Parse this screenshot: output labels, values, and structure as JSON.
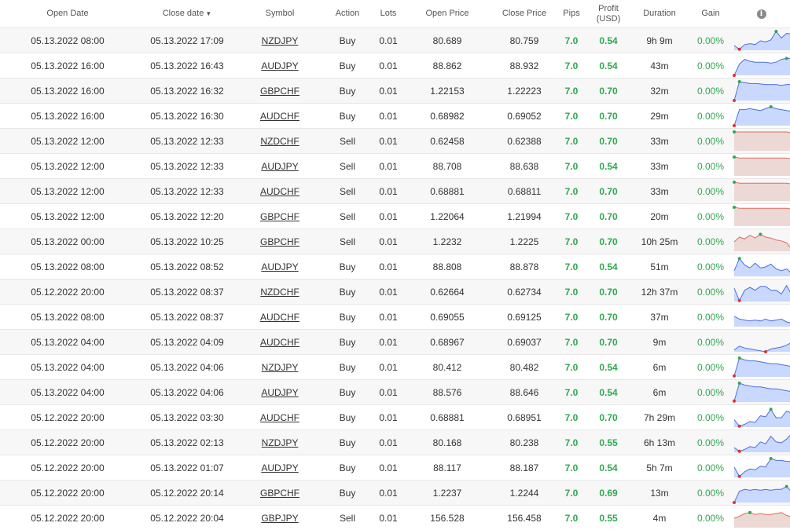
{
  "header": {
    "open_date": "Open Date",
    "close_date": "Close date",
    "close_date_sort": "▼",
    "symbol": "Symbol",
    "action": "Action",
    "lots": "Lots",
    "open_price": "Open Price",
    "close_price": "Close Price",
    "pips": "Pips",
    "profit_line1": "Profit",
    "profit_line2": "(USD)",
    "duration": "Duration",
    "gain": "Gain",
    "info_icon": "i"
  },
  "colors": {
    "profit": "#2fa84f",
    "buy_fill": "#c9d8ff",
    "buy_line": "#4f6fe0",
    "sell_fill": "#ecd9d6",
    "sell_line": "#e26b58",
    "marker_high": "#2fa84f",
    "marker_low": "#e03131"
  },
  "trades": [
    {
      "open_date": "05.13.2022 08:00",
      "close_date": "05.13.2022 17:09",
      "symbol": "NZDJPY",
      "action": "Buy",
      "lots": "0.01",
      "open_price": "80.689",
      "close_price": "80.759",
      "pips": "7.0",
      "profit": "0.54",
      "duration": "9h 9m",
      "gain": "0.00%",
      "spark": [
        0.25,
        0.05,
        0.3,
        0.35,
        0.3,
        0.5,
        0.45,
        0.55,
        1.0,
        0.65,
        0.9,
        0.85,
        0.35
      ]
    },
    {
      "open_date": "05.13.2022 16:00",
      "close_date": "05.13.2022 16:43",
      "symbol": "AUDJPY",
      "action": "Buy",
      "lots": "0.01",
      "open_price": "88.862",
      "close_price": "88.932",
      "pips": "7.0",
      "profit": "0.54",
      "duration": "43m",
      "gain": "0.00%",
      "spark": [
        0.0,
        0.6,
        0.85,
        0.75,
        0.7,
        0.7,
        0.7,
        0.65,
        0.7,
        0.85,
        0.9,
        0.9,
        0.2
      ]
    },
    {
      "open_date": "05.13.2022 16:00",
      "close_date": "05.13.2022 16:32",
      "symbol": "GBPCHF",
      "action": "Buy",
      "lots": "0.01",
      "open_price": "1.22153",
      "close_price": "1.22223",
      "pips": "7.0",
      "profit": "0.70",
      "duration": "32m",
      "gain": "0.00%",
      "spark": [
        0.0,
        1.0,
        0.95,
        0.9,
        0.9,
        0.88,
        0.85,
        0.85,
        0.85,
        0.8,
        0.85,
        0.85,
        0.2
      ]
    },
    {
      "open_date": "05.13.2022 16:00",
      "close_date": "05.13.2022 16:30",
      "symbol": "AUDCHF",
      "action": "Buy",
      "lots": "0.01",
      "open_price": "0.68982",
      "close_price": "0.69052",
      "pips": "7.0",
      "profit": "0.70",
      "duration": "29m",
      "gain": "0.00%",
      "spark": [
        0.0,
        0.85,
        0.85,
        0.9,
        0.85,
        0.8,
        0.9,
        1.0,
        0.9,
        0.85,
        0.8,
        0.75,
        0.3
      ]
    },
    {
      "open_date": "05.13.2022 12:00",
      "close_date": "05.13.2022 12:33",
      "symbol": "NZDCHF",
      "action": "Sell",
      "lots": "0.01",
      "open_price": "0.62458",
      "close_price": "0.62388",
      "pips": "7.0",
      "profit": "0.70",
      "duration": "33m",
      "gain": "0.00%",
      "spark": [
        1.0,
        1.0,
        1.0,
        1.0,
        1.0,
        1.0,
        1.0,
        1.0,
        1.0,
        1.0,
        1.0,
        0.95,
        0.0
      ]
    },
    {
      "open_date": "05.13.2022 12:00",
      "close_date": "05.13.2022 12:33",
      "symbol": "AUDJPY",
      "action": "Sell",
      "lots": "0.01",
      "open_price": "88.708",
      "close_price": "88.638",
      "pips": "7.0",
      "profit": "0.54",
      "duration": "33m",
      "gain": "0.00%",
      "spark": [
        1.0,
        0.95,
        0.95,
        0.95,
        0.95,
        0.95,
        0.95,
        0.95,
        0.95,
        0.95,
        0.95,
        0.9,
        0.0
      ]
    },
    {
      "open_date": "05.13.2022 12:00",
      "close_date": "05.13.2022 12:33",
      "symbol": "AUDCHF",
      "action": "Sell",
      "lots": "0.01",
      "open_price": "0.68881",
      "close_price": "0.68811",
      "pips": "7.0",
      "profit": "0.70",
      "duration": "33m",
      "gain": "0.00%",
      "spark": [
        1.0,
        0.95,
        0.95,
        0.95,
        0.95,
        0.95,
        0.95,
        0.95,
        0.95,
        0.95,
        0.95,
        0.9,
        0.0
      ]
    },
    {
      "open_date": "05.13.2022 12:00",
      "close_date": "05.13.2022 12:20",
      "symbol": "GBPCHF",
      "action": "Sell",
      "lots": "0.01",
      "open_price": "1.22064",
      "close_price": "1.21994",
      "pips": "7.0",
      "profit": "0.70",
      "duration": "20m",
      "gain": "0.00%",
      "spark": [
        1.0,
        0.95,
        0.95,
        0.95,
        0.95,
        0.95,
        0.95,
        0.95,
        0.95,
        0.95,
        0.95,
        0.9,
        0.0
      ]
    },
    {
      "open_date": "05.13.2022 00:00",
      "close_date": "05.13.2022 10:25",
      "symbol": "GBPCHF",
      "action": "Sell",
      "lots": "0.01",
      "open_price": "1.2232",
      "close_price": "1.2225",
      "pips": "7.0",
      "profit": "0.70",
      "duration": "10h 25m",
      "gain": "0.00%",
      "spark": [
        0.5,
        0.75,
        0.65,
        0.85,
        0.7,
        0.9,
        0.75,
        0.7,
        0.6,
        0.55,
        0.45,
        0.1,
        0.35
      ]
    },
    {
      "open_date": "05.13.2022 08:00",
      "close_date": "05.13.2022 08:52",
      "symbol": "AUDJPY",
      "action": "Buy",
      "lots": "0.01",
      "open_price": "88.808",
      "close_price": "88.878",
      "pips": "7.0",
      "profit": "0.54",
      "duration": "51m",
      "gain": "0.00%",
      "spark": [
        0.3,
        0.95,
        0.6,
        0.45,
        0.7,
        0.45,
        0.5,
        0.65,
        0.4,
        0.3,
        0.4,
        0.15,
        0.9
      ]
    },
    {
      "open_date": "05.12.2022 20:00",
      "close_date": "05.13.2022 08:37",
      "symbol": "NZDCHF",
      "action": "Buy",
      "lots": "0.01",
      "open_price": "0.62664",
      "close_price": "0.62734",
      "pips": "7.0",
      "profit": "0.70",
      "duration": "12h 37m",
      "gain": "0.00%",
      "spark": [
        0.7,
        0.05,
        0.6,
        0.75,
        0.6,
        0.8,
        0.8,
        0.6,
        0.6,
        0.4,
        0.85,
        0.35,
        1.0
      ]
    },
    {
      "open_date": "05.13.2022 08:00",
      "close_date": "05.13.2022 08:37",
      "symbol": "AUDCHF",
      "action": "Buy",
      "lots": "0.01",
      "open_price": "0.69055",
      "close_price": "0.69125",
      "pips": "7.0",
      "profit": "0.70",
      "duration": "37m",
      "gain": "0.00%",
      "spark": [
        0.55,
        0.4,
        0.35,
        0.3,
        0.35,
        0.3,
        0.4,
        0.3,
        0.35,
        0.4,
        0.25,
        0.2,
        1.0
      ]
    },
    {
      "open_date": "05.13.2022 04:00",
      "close_date": "05.13.2022 04:09",
      "symbol": "AUDCHF",
      "action": "Buy",
      "lots": "0.01",
      "open_price": "0.68967",
      "close_price": "0.69037",
      "pips": "7.0",
      "profit": "0.70",
      "duration": "9m",
      "gain": "0.00%",
      "spark": [
        0.1,
        0.3,
        0.2,
        0.15,
        0.1,
        0.05,
        0.0,
        0.15,
        0.2,
        0.25,
        0.35,
        0.5,
        1.0
      ]
    },
    {
      "open_date": "05.13.2022 04:00",
      "close_date": "05.13.2022 04:06",
      "symbol": "NZDJPY",
      "action": "Buy",
      "lots": "0.01",
      "open_price": "80.412",
      "close_price": "80.482",
      "pips": "7.0",
      "profit": "0.54",
      "duration": "6m",
      "gain": "0.00%",
      "spark": [
        0.05,
        1.0,
        0.9,
        0.85,
        0.85,
        0.8,
        0.75,
        0.7,
        0.7,
        0.65,
        0.6,
        0.55,
        0.2
      ]
    },
    {
      "open_date": "05.13.2022 04:00",
      "close_date": "05.13.2022 04:06",
      "symbol": "AUDJPY",
      "action": "Buy",
      "lots": "0.01",
      "open_price": "88.576",
      "close_price": "88.646",
      "pips": "7.0",
      "profit": "0.54",
      "duration": "6m",
      "gain": "0.00%",
      "spark": [
        0.05,
        1.0,
        0.9,
        0.85,
        0.8,
        0.8,
        0.75,
        0.7,
        0.7,
        0.65,
        0.6,
        0.55,
        0.2
      ]
    },
    {
      "open_date": "05.12.2022 20:00",
      "close_date": "05.13.2022 03:30",
      "symbol": "AUDCHF",
      "action": "Buy",
      "lots": "0.01",
      "open_price": "0.68881",
      "close_price": "0.68951",
      "pips": "7.0",
      "profit": "0.70",
      "duration": "7h 29m",
      "gain": "0.00%",
      "spark": [
        0.4,
        0.05,
        0.15,
        0.3,
        0.25,
        0.6,
        0.55,
        0.95,
        0.5,
        0.5,
        0.85,
        0.75,
        0.2
      ]
    },
    {
      "open_date": "05.12.2022 20:00",
      "close_date": "05.13.2022 02:13",
      "symbol": "NZDJPY",
      "action": "Buy",
      "lots": "0.01",
      "open_price": "80.168",
      "close_price": "80.238",
      "pips": "7.0",
      "profit": "0.55",
      "duration": "6h 13m",
      "gain": "0.00%",
      "spark": [
        0.25,
        0.05,
        0.15,
        0.3,
        0.25,
        0.55,
        0.45,
        0.85,
        0.55,
        0.5,
        0.7,
        1.0,
        0.35
      ]
    },
    {
      "open_date": "05.12.2022 20:00",
      "close_date": "05.13.2022 01:07",
      "symbol": "AUDJPY",
      "action": "Buy",
      "lots": "0.01",
      "open_price": "88.117",
      "close_price": "88.187",
      "pips": "7.0",
      "profit": "0.54",
      "duration": "5h 7m",
      "gain": "0.00%",
      "spark": [
        0.55,
        0.05,
        0.3,
        0.45,
        0.4,
        0.6,
        0.55,
        1.0,
        0.9,
        0.9,
        0.85,
        0.85,
        0.85
      ]
    },
    {
      "open_date": "05.12.2022 20:00",
      "close_date": "05.12.2022 20:14",
      "symbol": "GBPCHF",
      "action": "Buy",
      "lots": "0.01",
      "open_price": "1.2237",
      "close_price": "1.2244",
      "pips": "7.0",
      "profit": "0.69",
      "duration": "13m",
      "gain": "0.00%",
      "spark": [
        0.0,
        0.6,
        0.7,
        0.65,
        0.7,
        0.65,
        0.7,
        0.65,
        0.7,
        0.7,
        0.85,
        0.55,
        0.8
      ]
    },
    {
      "open_date": "05.12.2022 20:00",
      "close_date": "05.12.2022 20:04",
      "symbol": "GBPJPY",
      "action": "Sell",
      "lots": "0.01",
      "open_price": "156.528",
      "close_price": "156.458",
      "pips": "7.0",
      "profit": "0.55",
      "duration": "4m",
      "gain": "0.00%",
      "spark": [
        0.5,
        0.6,
        0.75,
        0.8,
        0.7,
        0.75,
        0.7,
        0.7,
        0.75,
        0.8,
        0.65,
        0.55,
        0.0
      ]
    }
  ]
}
